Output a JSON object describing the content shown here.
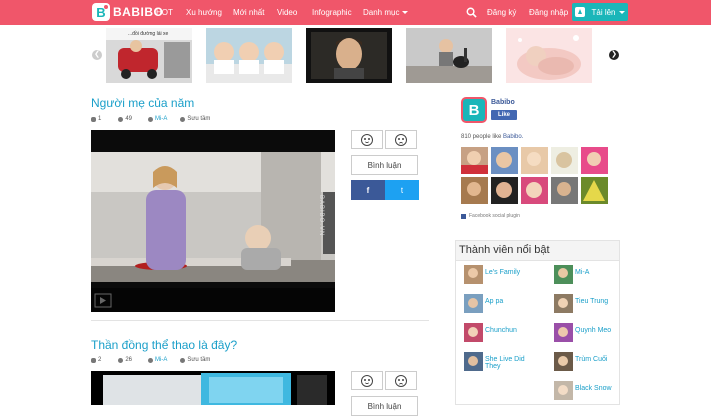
{
  "nav": {
    "brand": "BABIBO",
    "items": [
      {
        "label": "HOT"
      },
      {
        "label": "Xu hướng"
      },
      {
        "label": "Mới nhất"
      },
      {
        "label": "Video"
      },
      {
        "label": "Infographic"
      },
      {
        "label": "Danh mục"
      }
    ],
    "register": "Đăng ký",
    "login": "Đăng nhập",
    "upload": "Tải lên"
  },
  "carousel": {
    "thumbs": [
      {
        "caption": "...đồi đường lái xe",
        "icon": "kid-driving-thumb"
      },
      {
        "icon": "triplet-babies-thumb"
      },
      {
        "icon": "boy-portrait-thumb"
      },
      {
        "icon": "baby-guitar-thumb"
      },
      {
        "icon": "sleeping-baby-thumb"
      }
    ]
  },
  "posts": [
    {
      "title": "Người mẹ của năm",
      "likes": "1",
      "views": "49",
      "author": "Mi-A",
      "source": "Sưu tầm",
      "video_watermark": "BABIBO.VN",
      "comment_label": "Bình luận",
      "share_fb": "f",
      "share_tw": "t"
    },
    {
      "title": "Thần đồng thể thao là đây?",
      "likes": "2",
      "views": "26",
      "author": "Mi-A",
      "source": "Sưu tầm",
      "comment_label": "Bình luận"
    }
  ],
  "facebook": {
    "page_name": "Babibo",
    "like_label": "Like",
    "count_text": "810 people like",
    "count_link": "Babibo.",
    "plugin_label": "Facebook social plugin"
  },
  "members": {
    "heading": "Thành viên nổi bật",
    "list": [
      {
        "name": "Le's Family"
      },
      {
        "name": "Mi-A"
      },
      {
        "name": "Ap pa"
      },
      {
        "name": "Tieu Trung"
      },
      {
        "name": "Chunchun"
      },
      {
        "name": "Quynh Meo"
      },
      {
        "name": "She Live Did They"
      },
      {
        "name": "Trùm Cuối"
      },
      {
        "name": ""
      },
      {
        "name": "Black Snow"
      }
    ]
  },
  "colors": {
    "brand": "#f0566a",
    "accent": "#1ab6b9",
    "link": "#1a9fc9",
    "facebook": "#3b5998"
  }
}
